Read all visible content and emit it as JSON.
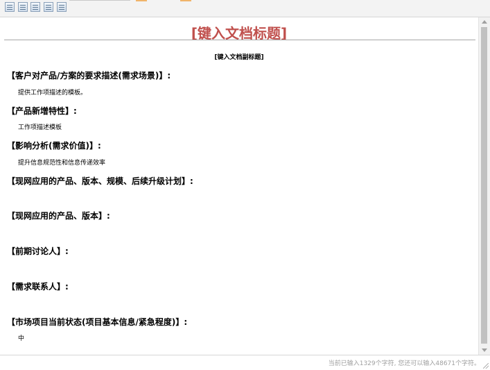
{
  "toolbar": {
    "buttons": [
      {
        "icon": "table-icon"
      },
      {
        "icon": "insert-row-icon"
      },
      {
        "icon": "insert-column-icon"
      },
      {
        "icon": "delete-row-icon"
      },
      {
        "icon": "merge-cells-icon"
      }
    ]
  },
  "document": {
    "title": "[键入文档标题]",
    "subtitle": "[键入文档副标题]",
    "sections": [
      {
        "heading": "【客户对产品/方案的要求描述(需求场景)】:",
        "body": "提供工作项描述的模板。"
      },
      {
        "heading": "【产品新增特性】:",
        "body": "工作项描述模板"
      },
      {
        "heading": "【影响分析(需求价值)】:",
        "body": "提升信息规范性和信息传递效率"
      },
      {
        "heading": "【现网应用的产品、版本、规模、后续升级计划】:",
        "body": ""
      },
      {
        "heading": "【现网应用的产品、版本】:",
        "body": ""
      },
      {
        "heading": "【前期讨论人】:",
        "body": ""
      },
      {
        "heading": "【需求联系人】:",
        "body": ""
      },
      {
        "heading": "【市场项目当前状态(项目基本信息/紧急程度)】:",
        "body": "中"
      }
    ]
  },
  "status": {
    "text": "当前已输入1329个字符, 您还可以输入48671个字符。"
  },
  "colors": {
    "title": "#c0504d",
    "status_text": "#a0a0a0",
    "toolbar_bg": "#f3f3f3"
  }
}
